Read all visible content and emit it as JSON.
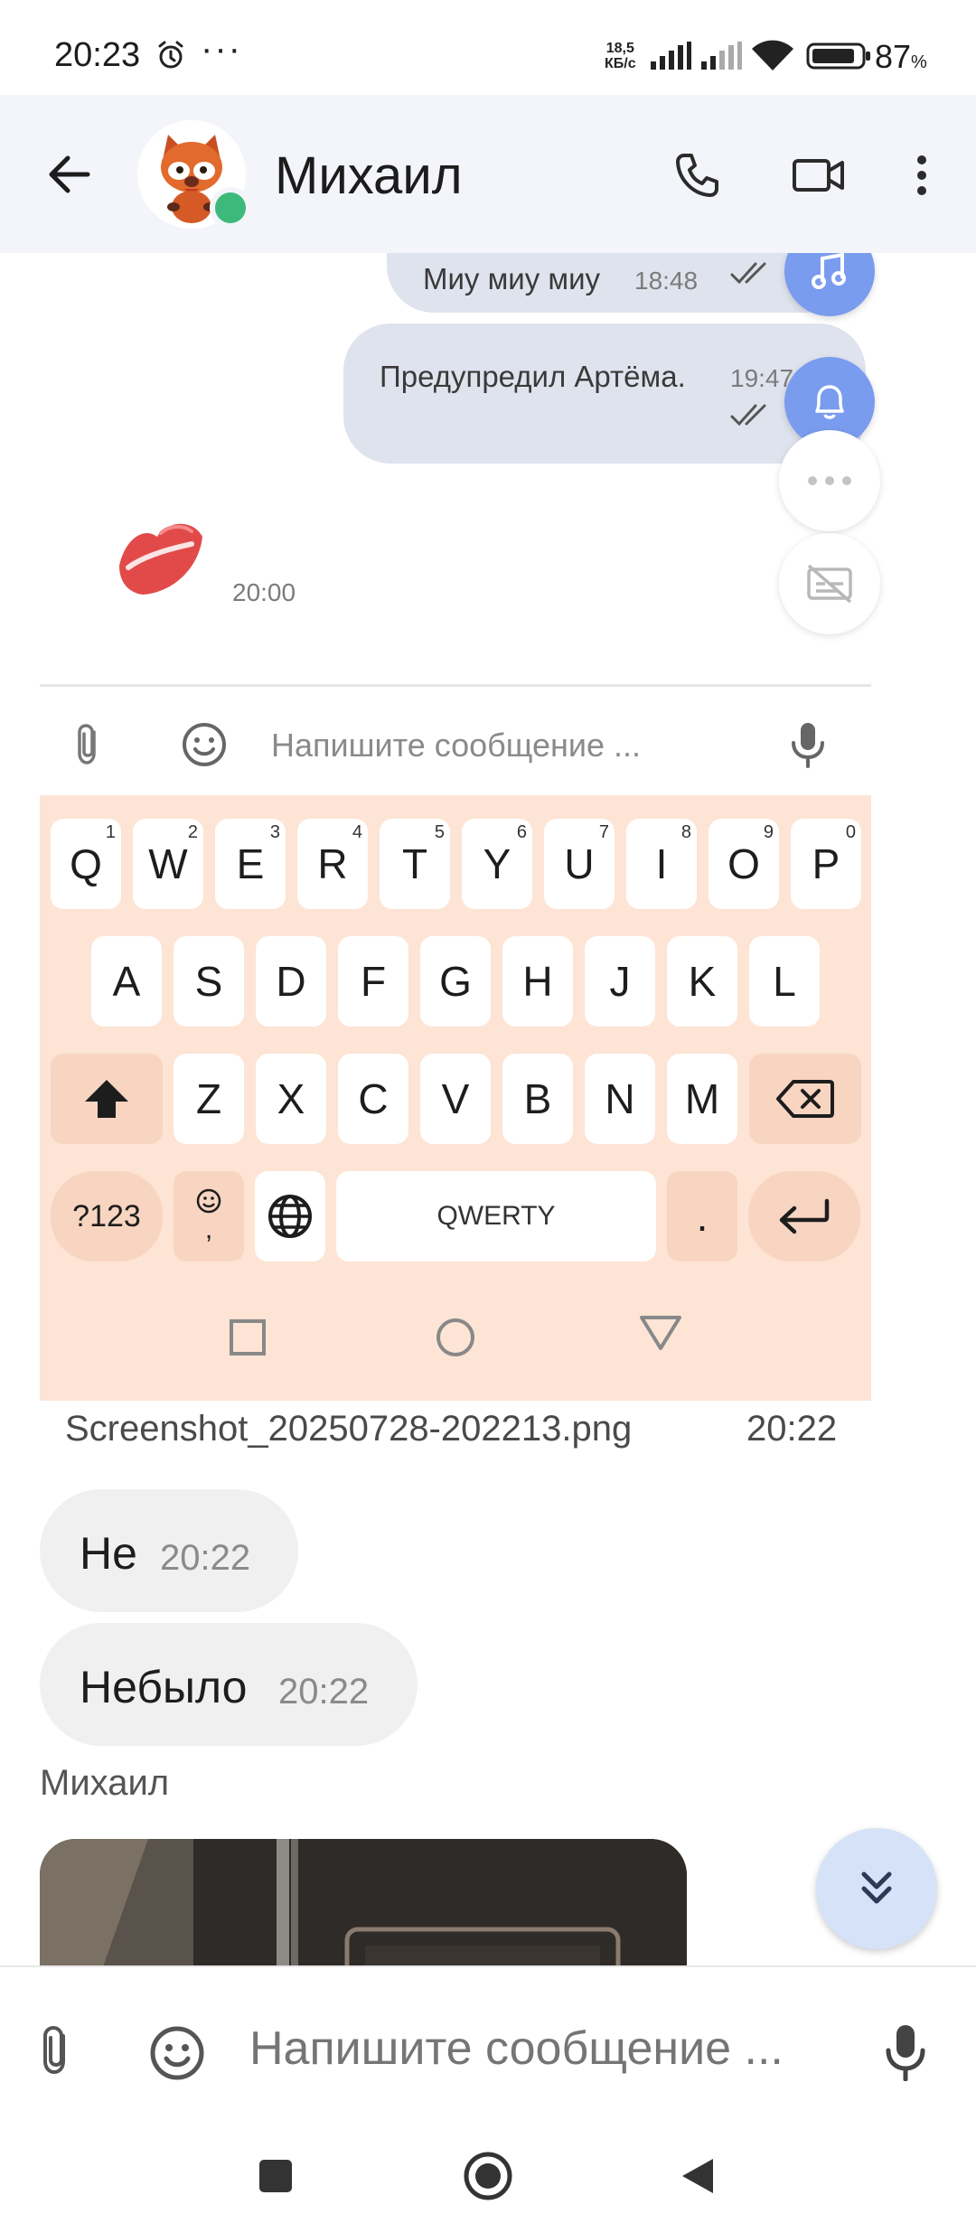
{
  "status_bar": {
    "time": "20:23",
    "dots": "···",
    "net_speed_value": "18,5",
    "net_speed_unit": "КБ/с",
    "battery_percent": "87",
    "battery_percent_sign": "%",
    "icons": [
      "alarm-icon",
      "signal-icon",
      "wifi-icon",
      "battery-icon"
    ]
  },
  "header": {
    "contact_name": "Михаил",
    "online": true,
    "icons": [
      "back-arrow-icon",
      "phone-icon",
      "video-camera-icon",
      "more-vert-icon"
    ]
  },
  "messages_out": [
    {
      "text": "Миу миу миу",
      "time": "18:48"
    },
    {
      "text": "Предупредил Артёма.",
      "time": "19:47"
    }
  ],
  "sticker": {
    "icon": "lips-kiss-icon",
    "time": "20:00"
  },
  "side_buttons": [
    "music-note-icon",
    "bell-icon",
    "more-horiz-icon",
    "subtitles-off-icon"
  ],
  "screenshot_preview": {
    "input_placeholder": "Напишите сообщение ...",
    "keyboard": {
      "row1": [
        {
          "k": "Q",
          "n": "1"
        },
        {
          "k": "W",
          "n": "2"
        },
        {
          "k": "E",
          "n": "3"
        },
        {
          "k": "R",
          "n": "4"
        },
        {
          "k": "T",
          "n": "5"
        },
        {
          "k": "Y",
          "n": "6"
        },
        {
          "k": "U",
          "n": "7"
        },
        {
          "k": "I",
          "n": "8"
        },
        {
          "k": "O",
          "n": "9"
        },
        {
          "k": "P",
          "n": "0"
        }
      ],
      "row2": [
        "A",
        "S",
        "D",
        "F",
        "G",
        "H",
        "J",
        "K",
        "L"
      ],
      "row3": [
        "Z",
        "X",
        "C",
        "V",
        "B",
        "N",
        "M"
      ],
      "sym_key": "?123",
      "emoji_comma": ",",
      "space_label": "QWERTY",
      "period": "."
    },
    "file_name": "Screenshot_20250728-202213.png",
    "file_time": "20:22"
  },
  "messages_in": [
    {
      "text": "Не",
      "time": "20:22"
    },
    {
      "text": "Небыло",
      "time": "20:22"
    }
  ],
  "sender_label": "Михаил",
  "composer": {
    "placeholder": "Напишите сообщение ..."
  },
  "colors": {
    "header_bg": "#f3f5fb",
    "bubble_out": "#dfe3ee",
    "bubble_in": "#f0f0f0",
    "keyboard_bg": "#fde4d4",
    "accent_blue": "#7a9cee",
    "online_green": "#3dba7b",
    "kiss_red": "#e24a4a"
  }
}
